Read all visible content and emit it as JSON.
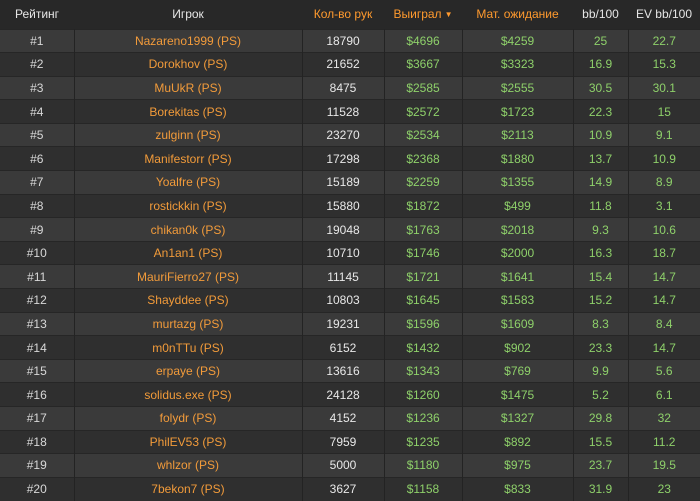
{
  "columns": [
    {
      "label": "Рейтинг",
      "color": "#e6e6e6"
    },
    {
      "label": "Игрок",
      "color": "#e6e6e6"
    },
    {
      "label": "Кол-во рук",
      "color": "#ff9a2e"
    },
    {
      "label": "Выиграл",
      "color": "#ff9a2e",
      "sorted": "desc"
    },
    {
      "label": "Мат. ожидание",
      "color": "#ff9a2e"
    },
    {
      "label": "bb/100",
      "color": "#e6e6e6"
    },
    {
      "label": "EV bb/100",
      "color": "#e6e6e6"
    }
  ],
  "rows": [
    {
      "rank": "#1",
      "player": "Nazareno1999 (PS)",
      "hands": "18790",
      "won": "$4696",
      "ev": "$4259",
      "bb100": "25",
      "evbb100": "22.7"
    },
    {
      "rank": "#2",
      "player": "Dorokhov (PS)",
      "hands": "21652",
      "won": "$3667",
      "ev": "$3323",
      "bb100": "16.9",
      "evbb100": "15.3"
    },
    {
      "rank": "#3",
      "player": "MuUkR (PS)",
      "hands": "8475",
      "won": "$2585",
      "ev": "$2555",
      "bb100": "30.5",
      "evbb100": "30.1"
    },
    {
      "rank": "#4",
      "player": "Borekitas (PS)",
      "hands": "11528",
      "won": "$2572",
      "ev": "$1723",
      "bb100": "22.3",
      "evbb100": "15"
    },
    {
      "rank": "#5",
      "player": "zulginn (PS)",
      "hands": "23270",
      "won": "$2534",
      "ev": "$2113",
      "bb100": "10.9",
      "evbb100": "9.1"
    },
    {
      "rank": "#6",
      "player": "Manifestorr (PS)",
      "hands": "17298",
      "won": "$2368",
      "ev": "$1880",
      "bb100": "13.7",
      "evbb100": "10.9"
    },
    {
      "rank": "#7",
      "player": "Yoalfre (PS)",
      "hands": "15189",
      "won": "$2259",
      "ev": "$1355",
      "bb100": "14.9",
      "evbb100": "8.9"
    },
    {
      "rank": "#8",
      "player": "rostickkin (PS)",
      "hands": "15880",
      "won": "$1872",
      "ev": "$499",
      "bb100": "11.8",
      "evbb100": "3.1"
    },
    {
      "rank": "#9",
      "player": "chikan0k (PS)",
      "hands": "19048",
      "won": "$1763",
      "ev": "$2018",
      "bb100": "9.3",
      "evbb100": "10.6"
    },
    {
      "rank": "#10",
      "player": "An1an1 (PS)",
      "hands": "10710",
      "won": "$1746",
      "ev": "$2000",
      "bb100": "16.3",
      "evbb100": "18.7"
    },
    {
      "rank": "#11",
      "player": "MauriFierro27 (PS)",
      "hands": "11145",
      "won": "$1721",
      "ev": "$1641",
      "bb100": "15.4",
      "evbb100": "14.7"
    },
    {
      "rank": "#12",
      "player": "Shayddee (PS)",
      "hands": "10803",
      "won": "$1645",
      "ev": "$1583",
      "bb100": "15.2",
      "evbb100": "14.7"
    },
    {
      "rank": "#13",
      "player": "murtazg (PS)",
      "hands": "19231",
      "won": "$1596",
      "ev": "$1609",
      "bb100": "8.3",
      "evbb100": "8.4"
    },
    {
      "rank": "#14",
      "player": "m0nTTu (PS)",
      "hands": "6152",
      "won": "$1432",
      "ev": "$902",
      "bb100": "23.3",
      "evbb100": "14.7"
    },
    {
      "rank": "#15",
      "player": "erpaye (PS)",
      "hands": "13616",
      "won": "$1343",
      "ev": "$769",
      "bb100": "9.9",
      "evbb100": "5.6"
    },
    {
      "rank": "#16",
      "player": "solidus.exe (PS)",
      "hands": "24128",
      "won": "$1260",
      "ev": "$1475",
      "bb100": "5.2",
      "evbb100": "6.1"
    },
    {
      "rank": "#17",
      "player": "folydr (PS)",
      "hands": "4152",
      "won": "$1236",
      "ev": "$1327",
      "bb100": "29.8",
      "evbb100": "32"
    },
    {
      "rank": "#18",
      "player": "PhilEV53 (PS)",
      "hands": "7959",
      "won": "$1235",
      "ev": "$892",
      "bb100": "15.5",
      "evbb100": "11.2"
    },
    {
      "rank": "#19",
      "player": "whlzor (PS)",
      "hands": "5000",
      "won": "$1180",
      "ev": "$975",
      "bb100": "23.7",
      "evbb100": "19.5"
    },
    {
      "rank": "#20",
      "player": "7bekon7 (PS)",
      "hands": "3627",
      "won": "$1158",
      "ev": "$833",
      "bb100": "31.9",
      "evbb100": "23"
    }
  ]
}
